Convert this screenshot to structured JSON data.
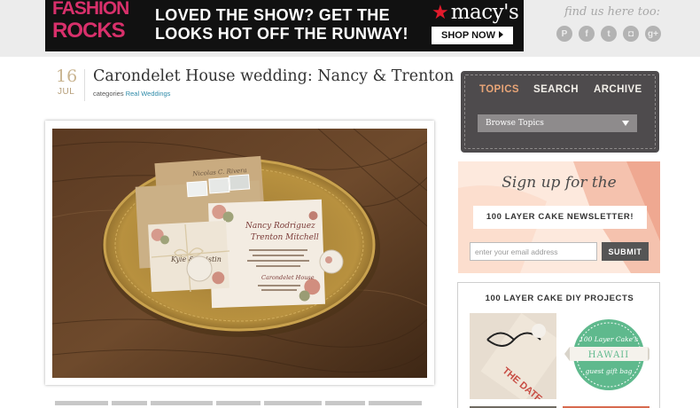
{
  "ad": {
    "brand_line1": "FASHION",
    "brand_line2": "ROCKS",
    "headline": "LOVED THE SHOW? GET THE LOOKS HOT OFF THE RUNWAY!",
    "retailer": "macy's",
    "cta": "SHOP NOW",
    "colors": {
      "brand": "#d8306b",
      "retailer_star": "#e21a2c",
      "background": "#111111"
    }
  },
  "social": {
    "heading": "find us here too:",
    "icons": [
      "pinterest-icon",
      "facebook-icon",
      "twitter-icon",
      "instagram-icon",
      "google-plus-icon"
    ],
    "glyphs": [
      "P",
      "f",
      "t",
      "◘",
      "g+"
    ]
  },
  "post": {
    "day": "16",
    "month": "JUL",
    "title": "Carondelet House wedding: Nancy & Trenton",
    "categories_label": "categories",
    "category": "Real Weddings",
    "photo": {
      "envelope_name": "Nicolas C. Rivera",
      "invite_from": "Mr. Jose Rodriguez & Mrs. Mariana Sosa",
      "bride": "Nancy Rodriguez",
      "groom": "Trenton Mitchell",
      "venue": "Carondelet House",
      "tag_text": "Kyle & Kristin"
    }
  },
  "sidebar": {
    "tabs": [
      "TOPICS",
      "SEARCH",
      "ARCHIVE"
    ],
    "browse_label": "Browse Topics",
    "newsletter": {
      "signup": "Sign up for the",
      "banner": "100 LAYER CAKE NEWSLETTER!",
      "email_placeholder": "enter your email address",
      "submit": "SUBMIT"
    },
    "diy": {
      "title": "100 LAYER CAKE DIY PROJECTS",
      "badge_top": "100 Layer Cake's",
      "badge_middle": "HAWAII",
      "badge_bottom": "guest gift bag",
      "thumb1_text": "THE DATE"
    },
    "colors": {
      "tab_active": "#e8a577",
      "badge": "#5fb98d"
    }
  }
}
